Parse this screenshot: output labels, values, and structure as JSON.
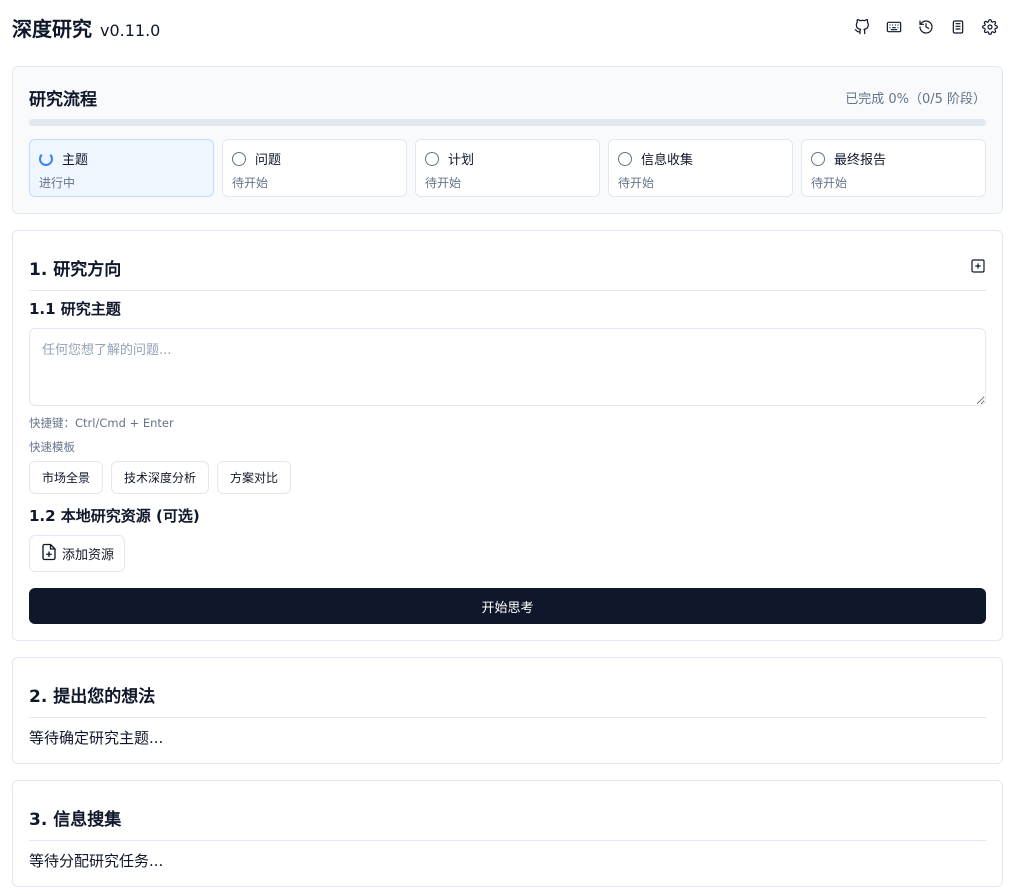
{
  "header": {
    "title": "深度研究",
    "version": "v0.11.0",
    "icons": [
      "github-icon",
      "keyboard-icon",
      "history-icon",
      "book-icon",
      "settings-icon"
    ]
  },
  "workflow": {
    "title": "研究流程",
    "progress_text": "已完成 0%（0/5 阶段）",
    "progress_percent": 0,
    "stages": [
      {
        "name": "主题",
        "status": "进行中",
        "state": "active"
      },
      {
        "name": "问题",
        "status": "待开始",
        "state": "pending"
      },
      {
        "name": "计划",
        "status": "待开始",
        "state": "pending"
      },
      {
        "name": "信息收集",
        "status": "待开始",
        "state": "pending"
      },
      {
        "name": "最终报告",
        "status": "待开始",
        "state": "pending"
      }
    ]
  },
  "section1": {
    "title": "1. 研究方向",
    "topic_title": "1.1 研究主题",
    "topic_placeholder": "任何您想了解的问题...",
    "topic_value": "",
    "shortcut_hint": "快捷键：Ctrl/Cmd + Enter",
    "templates_label": "快速模板",
    "templates": [
      "市场全景",
      "技术深度分析",
      "方案对比"
    ],
    "resources_title": "1.2 本地研究资源 (可选)",
    "add_resource_label": "添加资源",
    "start_button": "开始思考"
  },
  "section2": {
    "title": "2. 提出您的想法",
    "waiting_text": "等待确定研究主题..."
  },
  "section3": {
    "title": "3. 信息搜集",
    "waiting_text": "等待分配研究任务..."
  },
  "colors": {
    "primary": "#0f172a",
    "active_stage_bg": "#eff6ff",
    "spinner": "#3b82f6",
    "border": "#e2e8f0",
    "muted_text": "#64748b"
  }
}
